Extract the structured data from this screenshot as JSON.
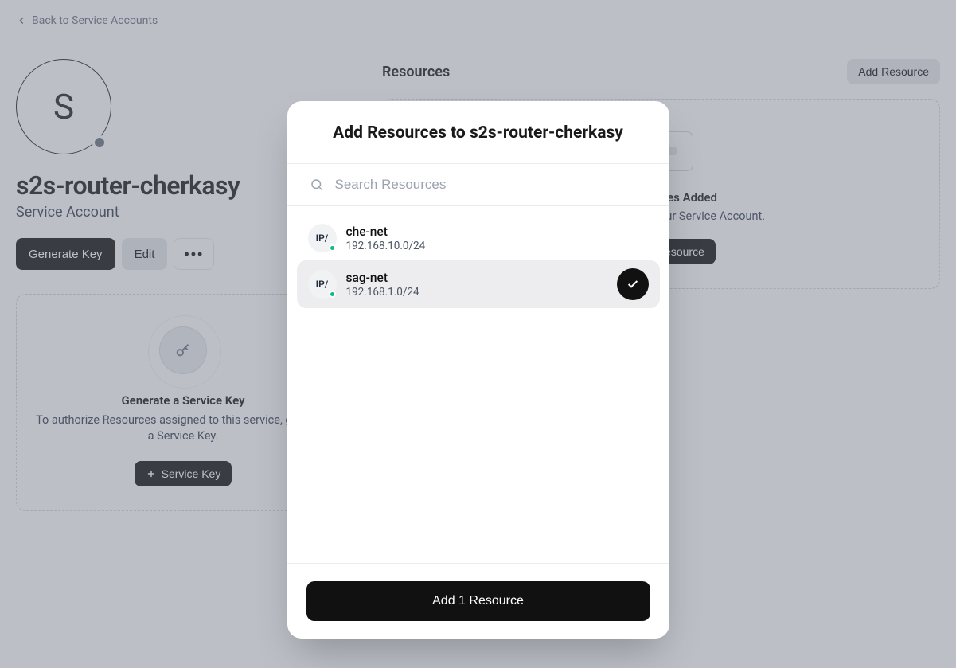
{
  "back_link": "Back to Service Accounts",
  "avatar_initial": "S",
  "account_name": "s2s-router-cherkasy",
  "account_type": "Service Account",
  "buttons": {
    "generate_key": "Generate Key",
    "edit": "Edit",
    "add_resource_header": "Add Resource"
  },
  "key_card": {
    "title": "Generate a Service Key",
    "desc": "To authorize Resources assigned to this service, generate a Service Key.",
    "button": "Service Key"
  },
  "resources": {
    "header": "Resources",
    "empty_title": "No Resources Added",
    "empty_desc": "Add a Resource to your Service Account.",
    "empty_button": "Add Resource"
  },
  "modal": {
    "title": "Add Resources to s2s-router-cherkasy",
    "search_placeholder": "Search Resources",
    "badge_text": "IP/",
    "items": [
      {
        "name": "che-net",
        "sub": "192.168.10.0/24",
        "selected": false
      },
      {
        "name": "sag-net",
        "sub": "192.168.1.0/24",
        "selected": true
      }
    ],
    "submit": "Add 1 Resource"
  }
}
